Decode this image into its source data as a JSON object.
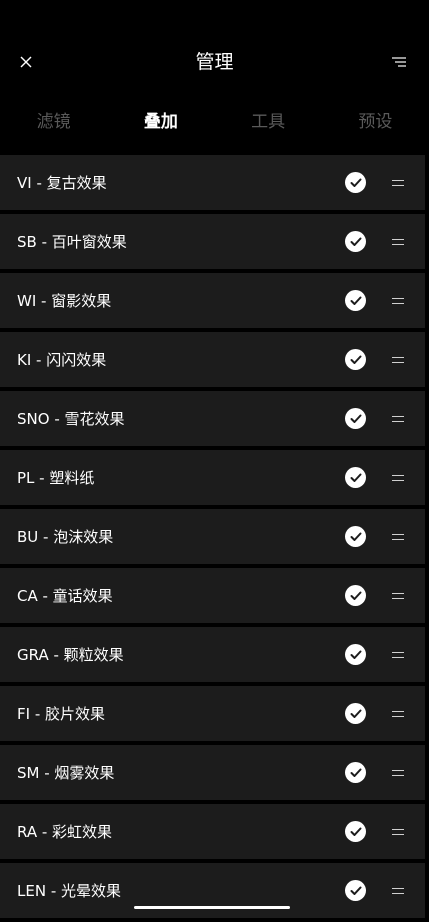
{
  "header": {
    "title": "管理",
    "close_icon": "close-icon",
    "sort_icon": "sort-lines-icon"
  },
  "tabs": [
    {
      "label": "滤镜",
      "active": false
    },
    {
      "label": "叠加",
      "active": true
    },
    {
      "label": "工具",
      "active": false
    },
    {
      "label": "预设",
      "active": false
    }
  ],
  "items": [
    {
      "label": "VI - 复古效果",
      "checked": true
    },
    {
      "label": "SB - 百叶窗效果",
      "checked": true
    },
    {
      "label": "WI - 窗影效果",
      "checked": true
    },
    {
      "label": "KI - 闪闪效果",
      "checked": true
    },
    {
      "label": "SNO - 雪花效果",
      "checked": true
    },
    {
      "label": "PL - 塑料纸",
      "checked": true
    },
    {
      "label": "BU - 泡沫效果",
      "checked": true
    },
    {
      "label": "CA - 童话效果",
      "checked": true
    },
    {
      "label": "GRA - 颗粒效果",
      "checked": true
    },
    {
      "label": "FI - 胶片效果",
      "checked": true
    },
    {
      "label": "SM - 烟雾效果",
      "checked": true
    },
    {
      "label": "RA - 彩虹效果",
      "checked": true
    },
    {
      "label": "LEN - 光晕效果",
      "checked": true
    }
  ],
  "colors": {
    "background": "#000000",
    "row": "#1c1c1c",
    "tab_inactive": "#5a5a5a",
    "text": "#ffffff"
  }
}
